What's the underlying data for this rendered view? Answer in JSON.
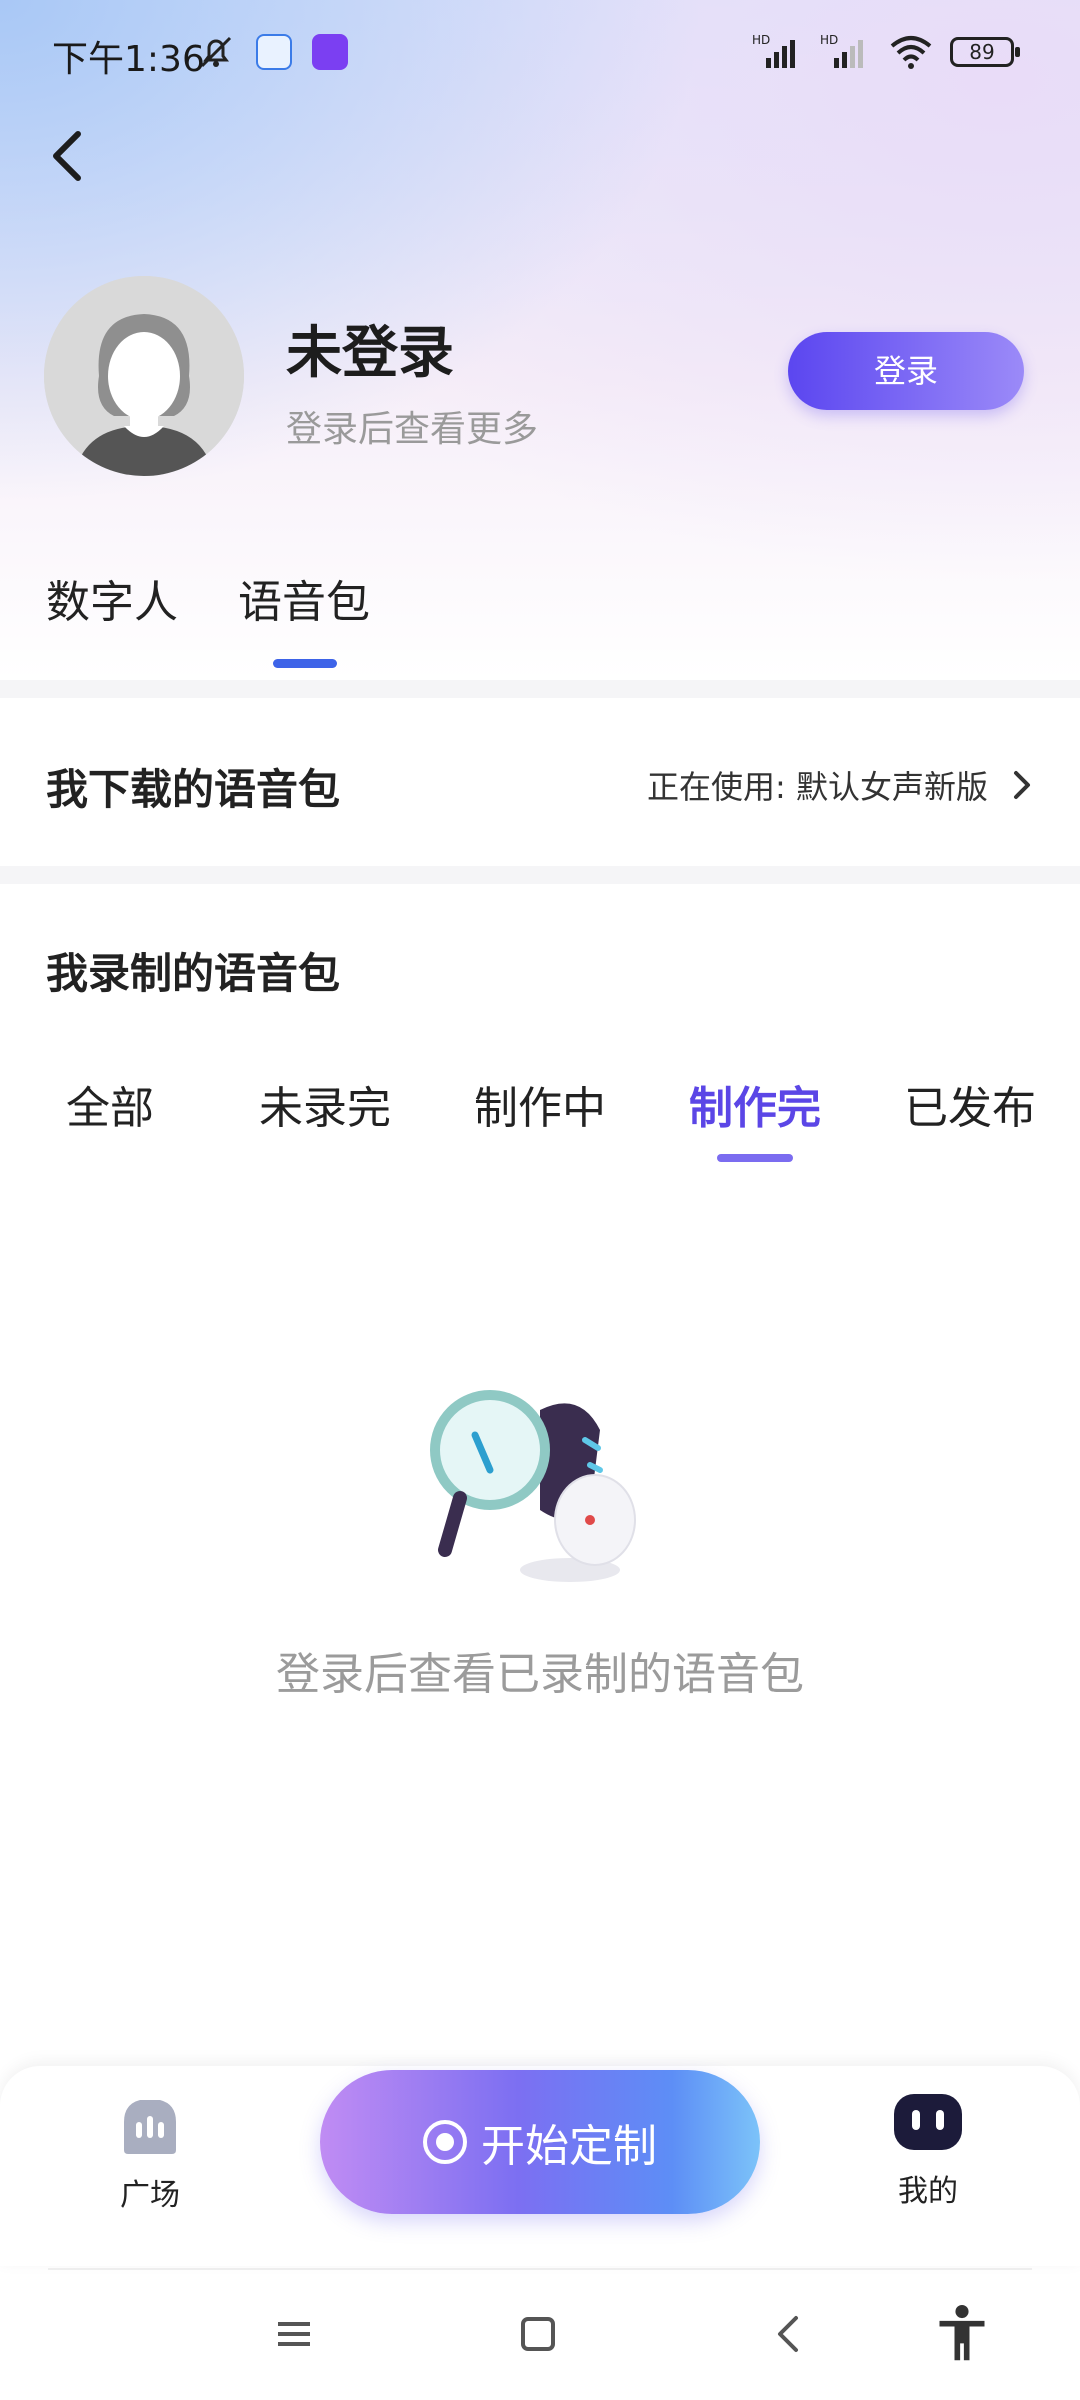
{
  "status_bar": {
    "time": "下午1:36",
    "battery": "89",
    "signal_label": "HD"
  },
  "header": {
    "back_icon": "chevron-left-icon"
  },
  "profile": {
    "name": "未登录",
    "subtitle": "登录后查看更多",
    "login_button": "登录"
  },
  "main_tabs": [
    {
      "label": "数字人",
      "active": false
    },
    {
      "label": "语音包",
      "active": true
    }
  ],
  "downloaded": {
    "title": "我下载的语音包",
    "using_label": "正在使用: 默认女声新版"
  },
  "recorded": {
    "title": "我录制的语音包",
    "tabs": [
      {
        "label": "全部",
        "active": false
      },
      {
        "label": "未录完",
        "active": false
      },
      {
        "label": "制作中",
        "active": false
      },
      {
        "label": "制作完",
        "active": true
      },
      {
        "label": "已发布",
        "active": false
      }
    ],
    "empty_text": "登录后查看已录制的语音包"
  },
  "bottom_nav": {
    "plaza_label": "广场",
    "start_label": "开始定制",
    "mine_label": "我的"
  },
  "colors": {
    "accent": "#5b46e6",
    "tab_indicator": "#3d63e8",
    "login_gradient_start": "#5b46f0"
  }
}
